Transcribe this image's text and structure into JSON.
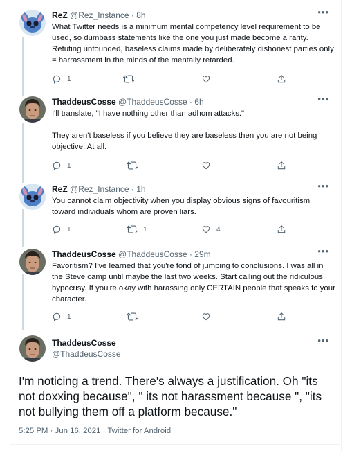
{
  "tweets": [
    {
      "display_name": "ReZ",
      "handle": "@Rez_Instance",
      "time": "· 8h",
      "avatar": "stitch-avatar",
      "text": "What Twitter needs is a minimum mental competency level requirement to be used, so dumbass statements like the one you just made become a rarity. Refuting unfounded, baseless claims made by deliberately dishonest parties only = harrassment in the minds of the mentally retarded.",
      "reply_count": "1",
      "retweet_count": "",
      "like_count": ""
    },
    {
      "display_name": "ThaddeusCosse",
      "handle": "@ThaddeusCosse",
      "time": "· 6h",
      "avatar": "man-avatar",
      "text_lines": [
        "I'll translate, \"I have nothing other than adhom attacks.\"",
        "",
        "They aren't baseless if you believe they are baseless then you are not being objective. At all."
      ],
      "reply_count": "1",
      "retweet_count": "",
      "like_count": ""
    },
    {
      "display_name": "ReZ",
      "handle": "@Rez_Instance",
      "time": "· 1h",
      "avatar": "stitch-avatar",
      "text": "You cannot claim objectivity when you display obvious signs of favouritism toward individuals whom are proven liars.",
      "reply_count": "1",
      "retweet_count": "1",
      "like_count": "4"
    },
    {
      "display_name": "ThaddeusCosse",
      "handle": "@ThaddeusCosse",
      "time": "· 29m",
      "avatar": "man-avatar",
      "text": "Favoritism?  I've learned that you're fond of jumping to conclusions.  I was all in the Steve camp until maybe the last two weeks.  Start calling out the ridiculous hypocrisy.  If you're okay with harassing only CERTAIN people that speaks to your character.",
      "reply_count": "1",
      "retweet_count": "",
      "like_count": ""
    }
  ],
  "main_tweet": {
    "display_name": "ThaddeusCosse",
    "handle": "@ThaddeusCosse",
    "text": "I'm noticing a trend.   There's always a  justification.  Oh \"its not doxxing because\", \" its not harassment because \", \"its not bullying them off a platform because.\"",
    "meta": "5:25 PM · Jun 16, 2021 · Twitter for Android"
  },
  "icons": {
    "more": "more-icon",
    "reply": "reply-icon",
    "retweet": "retweet-icon",
    "like": "like-icon",
    "share": "share-icon"
  },
  "colors": {
    "text": "#0f1419",
    "secondary": "#536471",
    "divider": "#eff3f4",
    "thread_line": "#cfd9de"
  }
}
